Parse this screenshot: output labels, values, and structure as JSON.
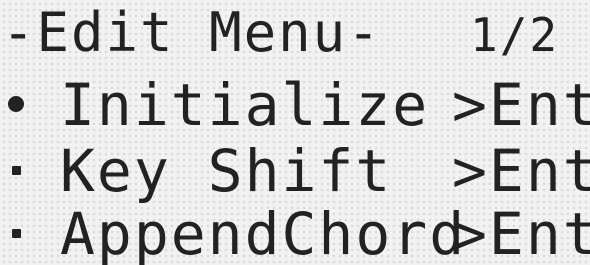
{
  "screen": {
    "title": "-Edit Menu-",
    "page_indicator": "1/2"
  },
  "menu": {
    "items": [
      {
        "label": "Initialize",
        "action": ">Ent",
        "selected": true
      },
      {
        "label": "Key Shift",
        "action": ">Ent",
        "selected": false
      },
      {
        "label": "AppendChord",
        "action": ">Ent",
        "selected": false
      }
    ]
  }
}
